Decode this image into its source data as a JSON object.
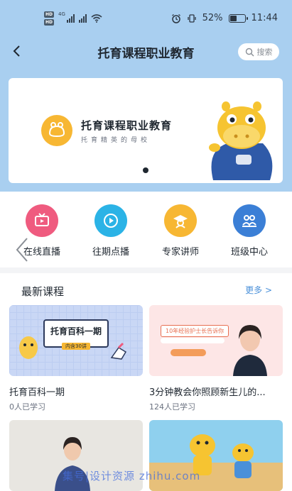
{
  "status_bar": {
    "sim_tags": [
      "HD",
      "HD"
    ],
    "network": "4G",
    "battery_text": "52%",
    "battery_level": 0.52,
    "time": "11:44"
  },
  "header": {
    "title": "托育课程职业教育",
    "search_label": "搜索"
  },
  "banner": {
    "title": "托育课程职业教育",
    "subtitle": "托育精英的母校",
    "slide_count": 1,
    "active_slide": 1
  },
  "menu": {
    "items": [
      {
        "label": "在线直播",
        "icon": "tv-icon",
        "color": "#ef5b7f"
      },
      {
        "label": "往期点播",
        "icon": "play-circle-icon",
        "color": "#2bb3e6"
      },
      {
        "label": "专家讲师",
        "icon": "graduation-cap-icon",
        "color": "#f7b733"
      },
      {
        "label": "班级中心",
        "icon": "group-icon",
        "color": "#3b7fd6"
      }
    ]
  },
  "section": {
    "title": "最新课程",
    "more_label": "更多 >"
  },
  "courses": [
    {
      "title": "托育百科一期",
      "meta": "0人已学习",
      "thumb_title": "托育百科一期",
      "thumb_tag": "内含30讲"
    },
    {
      "title": "3分钟教会你照顾新生儿的...",
      "meta": "124人已学习",
      "thumb_title": "10年经验护士长告诉你"
    },
    {
      "title": "",
      "meta": ""
    },
    {
      "title": "",
      "meta": ""
    }
  ],
  "watermark": "集号|设计资源 zhihu.com",
  "colors": {
    "hero_bg": "#a9cff0",
    "accent_link": "#4a90d9"
  }
}
